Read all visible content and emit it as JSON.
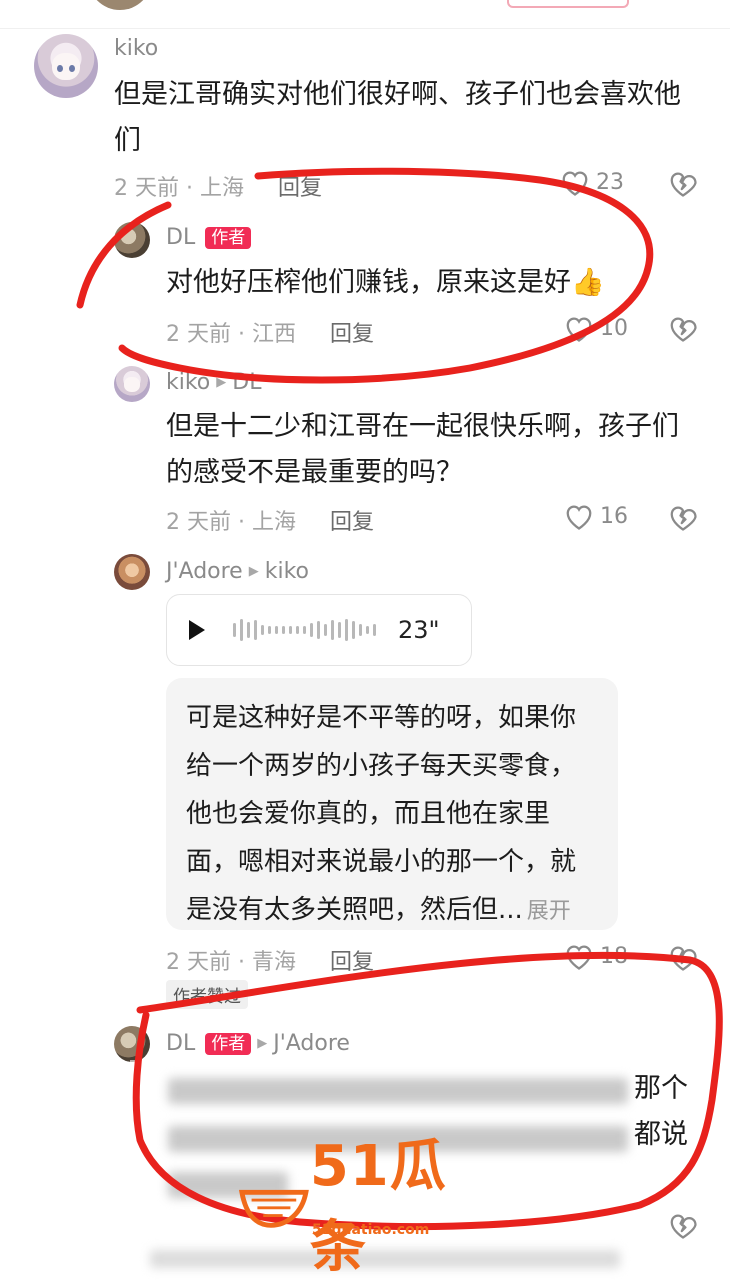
{
  "comments": [
    {
      "username": "kiko",
      "text_line1": "但是江哥确实对他们很好啊、孩子们也会喜欢他",
      "text_line2": "们",
      "time_location": "2 天前 · 上海",
      "reply_label": "回复",
      "likes": "23"
    },
    {
      "username": "DL",
      "author_badge": "作者",
      "text": "对他好压榨他们赚钱，原来这是好",
      "emoji": "👍",
      "time_location": "2 天前 · 江西",
      "reply_label": "回复",
      "likes": "10"
    },
    {
      "username": "kiko",
      "reply_to": "DL",
      "text_line1": "但是十二少和江哥在一起很快乐啊，孩子们",
      "text_line2": "的感受不是最重要的吗？",
      "time_location": "2 天前 · 上海",
      "reply_label": "回复",
      "likes": "16"
    },
    {
      "username": "J'Adore",
      "reply_to": "kiko",
      "voice_duration": "23\"",
      "transcript_lines": [
        "可是这种好是不平等的呀，如果你",
        "给一个两岁的小孩子每天买零食，",
        "他也会爱你真的，而且他在家里",
        "面，嗯相对来说最小的那一个，就",
        "是没有太多关照吧，然后但..."
      ],
      "expand_label": "展开",
      "time_location": "2 天前 · 青海",
      "reply_label": "回复",
      "likes": "18",
      "author_liked_tag": "作者赞过"
    },
    {
      "username": "DL",
      "author_badge": "作者",
      "reply_to": "J'Adore",
      "visible_tail_line1": "那个",
      "visible_tail_line2": "都说"
    }
  ],
  "watermark": {
    "brand": "51瓜条",
    "url": "51guatiao.com"
  },
  "colors": {
    "author_badge": "#f12c55",
    "annotation_red": "#e8221d",
    "watermark": "#f06a1a"
  }
}
